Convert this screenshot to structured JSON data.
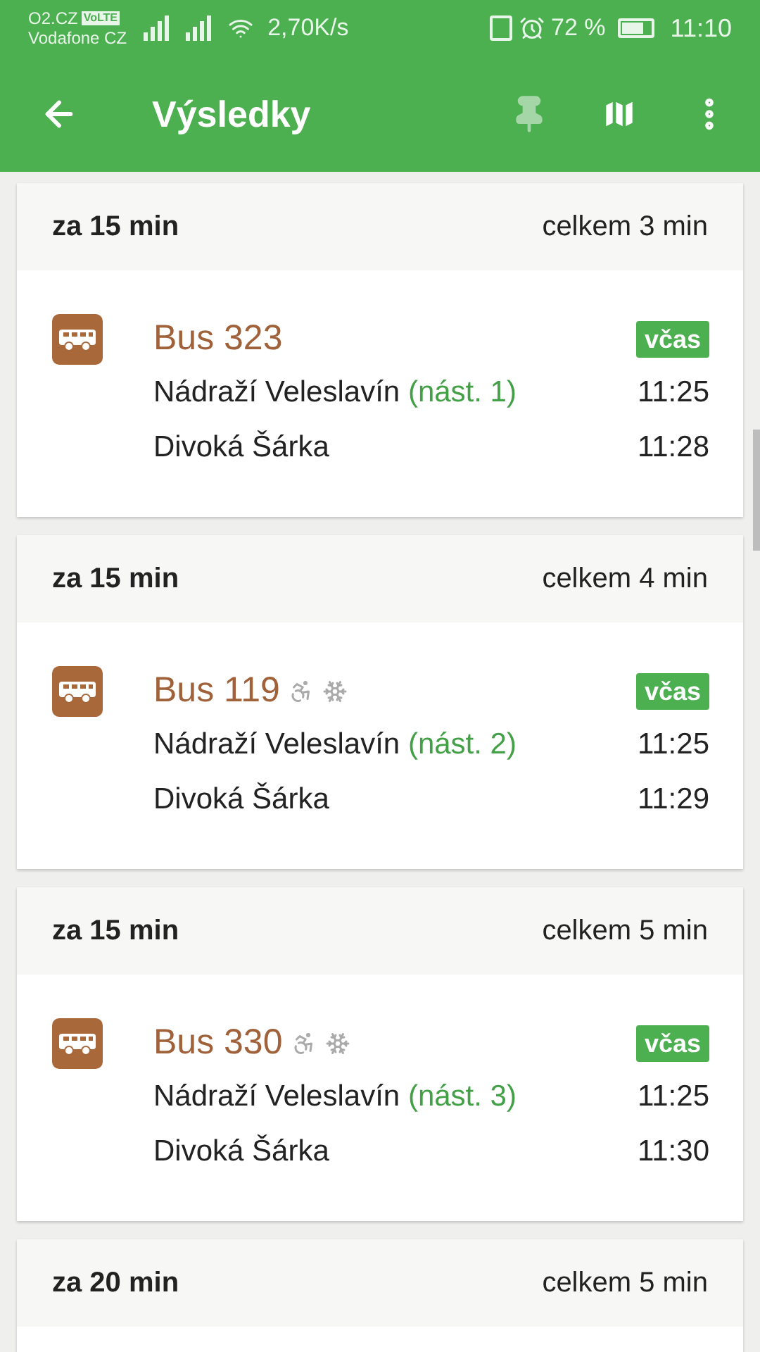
{
  "status_bar": {
    "carrier_1": "O2.CZ",
    "volte": "VoLTE",
    "carrier_2": "Vodafone CZ",
    "speed": "2,70K/s",
    "battery": "72 %",
    "time": "11:10"
  },
  "app_bar": {
    "title": "Výsledky",
    "pin_enabled": false
  },
  "results": [
    {
      "departs_in": "za 15 min",
      "total": "celkem 3 min",
      "line": "Bus 323",
      "wheelchair": false,
      "air_conditioning": false,
      "status": "včas",
      "from": "Nádraží Veleslavín",
      "platform": "(nást. 1)",
      "from_time": "11:25",
      "to": "Divoká Šárka",
      "to_time": "11:28"
    },
    {
      "departs_in": "za 15 min",
      "total": "celkem 4 min",
      "line": "Bus 119",
      "wheelchair": true,
      "air_conditioning": true,
      "status": "včas",
      "from": "Nádraží Veleslavín",
      "platform": "(nást. 2)",
      "from_time": "11:25",
      "to": "Divoká Šárka",
      "to_time": "11:29"
    },
    {
      "departs_in": "za 15 min",
      "total": "celkem 5 min",
      "line": "Bus 330",
      "wheelchair": true,
      "air_conditioning": true,
      "status": "včas",
      "from": "Nádraží Veleslavín",
      "platform": "(nást. 3)",
      "from_time": "11:25",
      "to": "Divoká Šárka",
      "to_time": "11:30"
    },
    {
      "departs_in": "za 20 min",
      "total": "celkem 5 min"
    }
  ]
}
